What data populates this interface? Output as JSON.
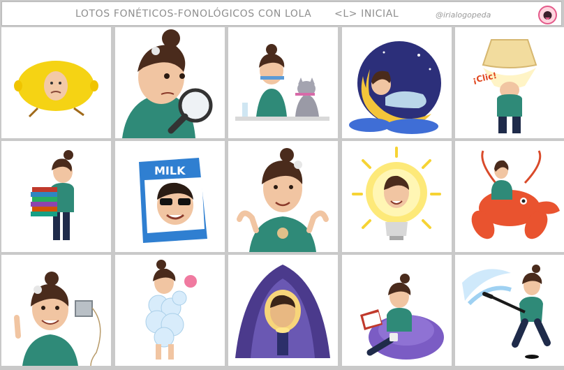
{
  "header": {
    "title": "LOTOS FONÉTICOS-FONOLÓGICOS CON LOLA",
    "phoneme": "<L>  INICIAL",
    "handle": "@irialogopeda"
  },
  "cards": [
    {
      "name": "limon"
    },
    {
      "name": "lupa"
    },
    {
      "name": "lavarse-dientes"
    },
    {
      "name": "luna"
    },
    {
      "name": "lampara",
      "caption": "¡Clic!"
    },
    {
      "name": "libros"
    },
    {
      "name": "leche",
      "caption": "MILK"
    },
    {
      "name": "lola"
    },
    {
      "name": "luz"
    },
    {
      "name": "langosta"
    },
    {
      "name": "lata-telefono"
    },
    {
      "name": "lavarse"
    },
    {
      "name": "linterna"
    },
    {
      "name": "leer"
    },
    {
      "name": "hockey"
    }
  ]
}
